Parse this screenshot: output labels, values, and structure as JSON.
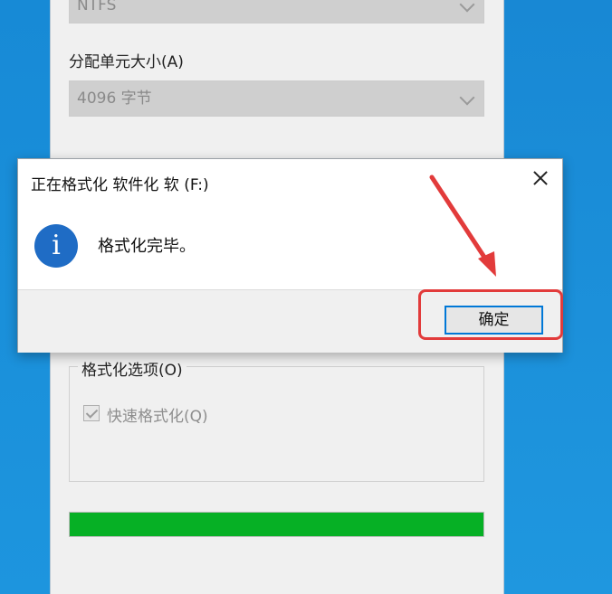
{
  "format_window": {
    "file_system_value": "NTFS",
    "cluster_size_label": "分配单元大小(A)",
    "cluster_size_value": "4096 字节",
    "options_label": "格式化选项(O)",
    "quick_format_label": "快速格式化(Q)",
    "progress_percent": 100,
    "progress_color": "#06b025"
  },
  "dialog": {
    "title": "正在格式化 软件化 软 (F:)",
    "icon": "info-icon",
    "message": "格式化完毕。",
    "ok_label": "确定"
  },
  "annotation": {
    "color": "#e23b3b"
  }
}
